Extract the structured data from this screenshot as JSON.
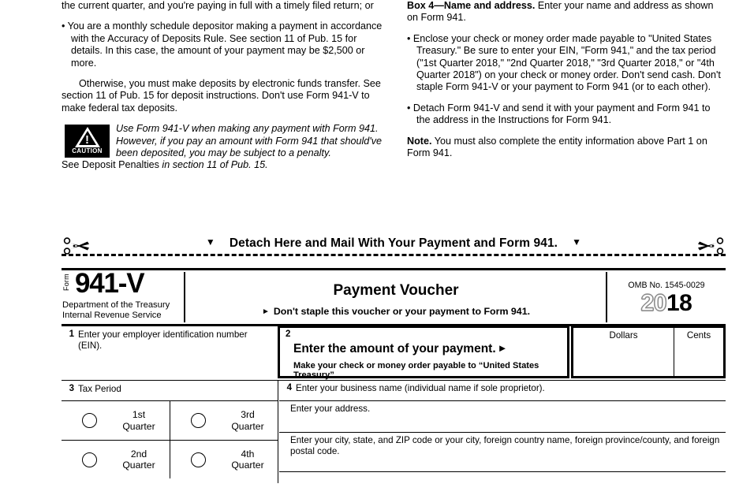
{
  "instructions": {
    "left_column": [
      {
        "type": "text",
        "text": "the current quarter, and you're paying in full with a timely filed return; or"
      },
      {
        "type": "bullet",
        "text": "•  You are a monthly schedule depositor making a payment in accordance with the Accuracy of Deposits Rule. See section 11 of Pub. 15 for details. In this case, the amount of your payment may be $2,500 or more."
      },
      {
        "type": "indent",
        "text": "Otherwise, you must make deposits by electronic funds transfer. See section 11 of Pub. 15 for deposit instructions. Don't use Form 941-V to make federal tax deposits."
      }
    ],
    "caution": {
      "icon_caption": "CAUTION",
      "italic_text": "Use Form 941-V when making any payment with Form 941. However, if you pay an amount with Form 941 that should've been deposited, you may be subject to a penalty.",
      "tail_plain": "See Deposit Penalties ",
      "tail_italic": "in section 11 of Pub. 15."
    },
    "right_column": {
      "box4_heading": "Box 4—Name and address.",
      "box4_text": " Enter your name and address as shown on Form 941.",
      "bullet1": "•  Enclose your check or money order made payable to \"United States Treasury.\" Be sure to enter your EIN, \"Form 941,\" and the tax period (\"1st Quarter 2018,\" \"2nd Quarter 2018,\" \"3rd Quarter 2018,\" or \"4th Quarter 2018\") on your check or money order. Don't send cash. Don't staple Form 941-V or your payment to Form 941 (or to each other).",
      "bullet2": "•  Detach Form 941-V and send it with your payment and Form 941 to the address in the Instructions for Form 941.",
      "note_heading": "Note.",
      "note_text": " You must also complete the entity information above Part 1 on Form 941."
    }
  },
  "detach": {
    "label": "Detach Here and Mail With Your Payment and Form 941.",
    "marker": "▼"
  },
  "voucher": {
    "form_word": "Form",
    "form_number": "941-V",
    "agency_line1": "Department of the Treasury",
    "agency_line2": "Internal Revenue Service",
    "title": "Payment Voucher",
    "subtitle": "Don't staple this voucher or your payment to Form 941.",
    "arrow": "►",
    "omb": "OMB No. 1545-0029",
    "year_hollow": "20",
    "year_solid": "18",
    "box1": {
      "number": "1",
      "label": "Enter your employer identification number (EIN)."
    },
    "box2": {
      "number": "2",
      "main": "Enter the amount of your payment.",
      "arrow": "►",
      "sub": "Make your check or money order payable to “United States Treasury”"
    },
    "money": {
      "dollars": "Dollars",
      "cents": "Cents"
    },
    "box3": {
      "number": "3",
      "label": "Tax Period",
      "quarters": [
        {
          "line1": "1st",
          "line2": "Quarter"
        },
        {
          "line1": "3rd",
          "line2": "Quarter"
        },
        {
          "line1": "2nd",
          "line2": "Quarter"
        },
        {
          "line1": "4th",
          "line2": "Quarter"
        }
      ]
    },
    "box4": {
      "number": "4",
      "label": "Enter your business name (individual name if sole proprietor).",
      "address_label": "Enter your address.",
      "city_label": "Enter your city, state, and ZIP code or your city, foreign country name, foreign province/county, and foreign postal code."
    }
  }
}
